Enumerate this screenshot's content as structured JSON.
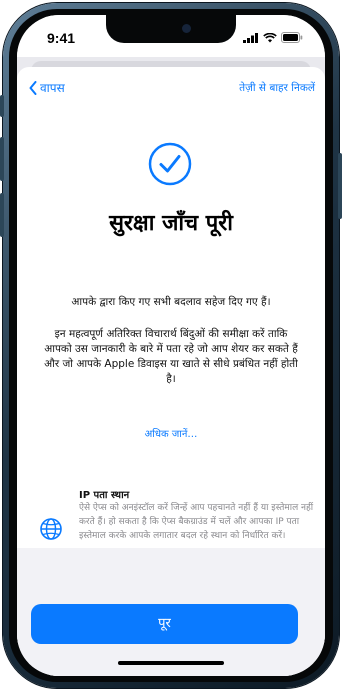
{
  "status_bar": {
    "time": "9:41"
  },
  "nav": {
    "back_label": "वापस",
    "exit_label": "तेज़ी से बाहर निकलें"
  },
  "title": "सुरक्षा जाँच पूरी",
  "message_1": "आपके द्वारा किए गए सभी बदलाव सहेज दिए गए हैं।",
  "message_2": "इन महत्वपूर्ण अतिरिक्त विचारार्थ बिंदुओं की समीक्षा करें ताकि आपको उस जानकारी के बारे में पता रहे जो आप शेयर कर सकते हैं और जो आपके Apple डिवाइस या खाते से सीधे प्रबंधित नहीं होती है।",
  "learn_more": "अधिक जानें…",
  "ip_section": {
    "title": "IP पता स्थान",
    "description": "ऐसे ऐप्स को अनइंस्टॉल करें जिन्हें आप पहचानते नहीं हैं या इस्तेमाल नहीं करते हैं। हो सकता है कि ऐप्स बैकग्राउंड में चलें और आपका IP पता इस्तेमाल करके आपके लगातार बदल रहे स्थान को निर्धारित करें।",
    "icon": "globe-icon"
  },
  "done_button": "पूर",
  "colors": {
    "accent": "#0a7aff",
    "footer_bg": "#f2f2f6",
    "secondary_text": "#8a8a8e"
  }
}
